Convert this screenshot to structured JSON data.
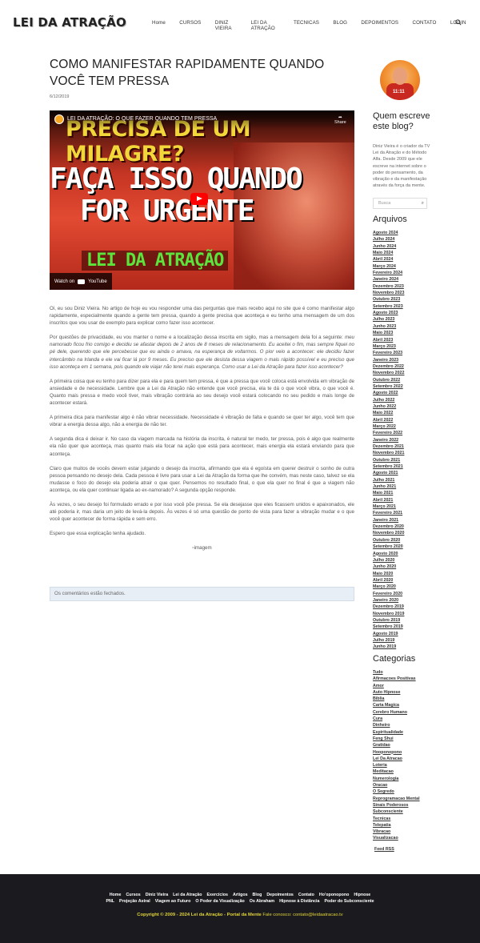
{
  "site": {
    "logo": "LEI DA ATRAÇÃO"
  },
  "nav": [
    "Home",
    "CURSOS",
    "DINIZ VIEIRA",
    "LEI DA ATRAÇÃO",
    "TECNICAS",
    "BLOG",
    "DEPOIMENTOS",
    "CONTATO",
    "LOGIN"
  ],
  "post": {
    "title": "COMO MANIFESTAR RAPIDAMENTE QUANDO VOCÊ TEM PRESSA",
    "date": "6/12/2019",
    "video": {
      "title": "LEI DA ATRAÇÃO: O QUE FAZER QUANDO TEM PRESSA",
      "share": "Share",
      "line1": "PRECISA DE UM MILAGRE?",
      "line2": "FAÇA ISSO QUANDO",
      "line3": "FOR URGENTE",
      "line4": "LEI DA ATRAÇÃO",
      "watch": "Watch on",
      "yt": "YouTube"
    },
    "paragraphs": [
      "Oi, eu sou Diniz Vieira. No artigo de hoje eu vou responder uma das perguntas que mais recebo aqui no site que é como manifestar algo rapidamente, especialmente quando a gente tem pressa, quando a gente precisa que aconteça e eu tenho uma mensagem de um dos inscritos que vou usar de exemplo para explicar como fazer isso acontecer.",
      "Por questões de privacidade, eu vou manter o nome e a localização dessa inscrita em sigilo, mas a mensagem dela foi a seguinte:",
      "meu namorado ficou frio comigo e decidiu se afastar depois de 2 anos de 8 meses de relacionamento. Eu aceitei o fim, mas sempre fiquei no pé dele, querendo que ele percebesse que eu ainda o amava, na esperança de voltarmos. O pior veio a acontecer: ele decidiu fazer intercâmbio na Irlanda e ele vai ficar lá por 9 meses. Eu preciso que ele desista dessa viagem o mais rápido possível e eu preciso que isso aconteça em 1 semana, pois quando ele viajar não terei mais esperança. Como usar a Lei da Atração para fazer isso acontecer?",
      "A primeira coisa que eu tenho para dizer para ela e para quem tem pressa, é que a pressa que você coloca está envolvida em vibração de ansiedade e de necessidade. Lembre que a Lei da Atração não entende que você precisa, ela te dá o que você vibra, o que você é. Quanto mais pressa e medo você tiver, mais vibração contrária ao seu desejo você estará colocando no seu pedido e mais longe de acontecer estará.",
      "A primeira dica para manifestar algo é não vibrar necessidade. Necessidade é vibração de falta e quando se quer ter algo, você tem que vibrar a energia dessa algo, não a energia de não ter.",
      "A segunda dica é deixar ir. No caso da viagem marcada na história da inscrita, é natural ter medo, ter pressa, pois é algo que realmente ela não quer que aconteça, mas quanto mais ela focar na ação que está para acontecer, mais energia ela estará enviando para que aconteça.",
      "Claro que muitos de vocês devem estar julgando o desejo da inscrita, afirmando que ela é egoísta em querer destruir o sonho de outra pessoa pensando no desejo dela. Cada pessoa é livre para usar a Lei da Atração da forma que lhe convém, mas neste caso, talvez se ela mudasse o foco do desejo ela poderia atrair o que quer. Pensemos no resultado final, o que ela quer no final é que a viagem não aconteça, ou ela quer continuar ligada ao ex-namorado? A segunda opção responde.",
      "Às vezes, o seu desejo foi formulado errado e por isso você põe pressa. Se ela desejasse que eles ficassem unidos e apaixonados, ele até poderia ir, mas daria um jeito de levá-la depois. Às vezes é só uma questão de ponto de vista para fazer a vibração mudar e o que você quer acontecer de forma rápida e sem erro.",
      "Espero que essa explicação tenha ajudado."
    ],
    "image_alt": "imagem",
    "comments_closed": "Os comentários estão fechados."
  },
  "sidebar": {
    "who_title": "Quem escreve este blog?",
    "who_text": "Diniz Vieira é o criador da TV Lei da Atração e do Método Alfa. Desde 2009 que ele escreve na internet sobre o poder do pensamento, da vibração e da manifestação através da força da mente.",
    "search_placeholder": "Busca",
    "archives_title": "Arquivos",
    "archives": [
      "Agosto 2024",
      "Julho 2024",
      "Junho 2024",
      "Maio 2024",
      "Abril 2024",
      "Março 2024",
      "Fevereiro 2024",
      "Janeiro 2024",
      "Dezembro 2023",
      "Novembro 2023",
      "Outubro 2023",
      "Setembro 2023",
      "Agosto 2023",
      "Julho 2023",
      "Junho 2023",
      "Maio 2023",
      "Abril 2023",
      "Março 2023",
      "Fevereiro 2023",
      "Janeiro 2023",
      "Dezembro 2022",
      "Novembro 2022",
      "Outubro 2022",
      "Setembro 2022",
      "Agosto 2022",
      "Julho 2022",
      "Junho 2022",
      "Maio 2022",
      "Abril 2022",
      "Março 2022",
      "Fevereiro 2022",
      "Janeiro 2022",
      "Dezembro 2021",
      "Novembro 2021",
      "Outubro 2021",
      "Setembro 2021",
      "Agosto 2021",
      "Julho 2021",
      "Junho 2021",
      "Maio 2021",
      "Abril 2021",
      "Março 2021",
      "Fevereiro 2021",
      "Janeiro 2021",
      "Dezembro 2020",
      "Novembro 2020",
      "Outubro 2020",
      "Setembro 2020",
      "Agosto 2020",
      "Julho 2020",
      "Junho 2020",
      "Maio 2020",
      "Abril 2020",
      "Março 2020",
      "Fevereiro 2020",
      "Janeiro 2020",
      "Dezembro 2019",
      "Novembro 2019",
      "Outubro 2019",
      "Setembro 2019",
      "Agosto 2019",
      "Julho 2019",
      "Junho 2019"
    ],
    "categories_title": "Categorias",
    "categories": [
      "Tudo",
      "Afirmacoes Positivas",
      "Amor",
      "Auto Hipnose",
      "Biblia",
      "Carta Magica",
      "Cerebro Humano",
      "Cura",
      "Dinheiro",
      "Espiritualidade",
      "Feng Shui",
      "Gratidao",
      "Hooponopono",
      "Lei Da Atracao",
      "Loteria",
      "Meditacao",
      "Numerologia",
      "Oracao",
      "O Segredo",
      "Reprogramacao Mental",
      "Sinais Poderosos",
      "Subconsciente",
      "Tecnicas",
      "Telepatia",
      "Vibracao",
      "Visualizacao"
    ],
    "feed": "Feed RSS"
  },
  "footer": {
    "row1": [
      "Home",
      "Cursos",
      "Diniz Vieira",
      "Lei da Atração",
      "Exercícios",
      "Artigos",
      "Blog",
      "Depoimentos",
      "Contato",
      "Ho'oponopono",
      "Hipnose"
    ],
    "row2": [
      "PNL",
      "Projeção Astral",
      "Viagem ao Futuro",
      "O Poder da Visualização",
      "Os Abraham",
      "Hipnose à Distância",
      "Poder do Subconsciente"
    ],
    "copyright": "Copyright © 2009 - 2024 Lei da Atração - Portal da Mente",
    "contact": "Fale conosco: contato@leidaatracao.tv"
  }
}
